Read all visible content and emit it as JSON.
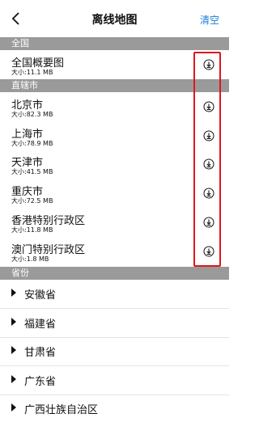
{
  "header": {
    "title": "离线地图",
    "clear_label": "清空"
  },
  "sections": {
    "national": "全国",
    "municipalities": "直辖市",
    "provinces": "省份"
  },
  "national": {
    "name": "全国概要图",
    "size": "大小:11.1 MB"
  },
  "cities": [
    {
      "name": "北京市",
      "size": "大小:82.3 MB"
    },
    {
      "name": "上海市",
      "size": "大小:78.9 MB"
    },
    {
      "name": "天津市",
      "size": "大小:41.5 MB"
    },
    {
      "name": "重庆市",
      "size": "大小:72.5 MB"
    },
    {
      "name": "香港特别行政区",
      "size": "大小:11.8 MB"
    },
    {
      "name": "澳门特别行政区",
      "size": "大小:1.8 MB"
    }
  ],
  "provinces": [
    "安徽省",
    "福建省",
    "甘肃省",
    "广东省",
    "广西壮族自治区"
  ],
  "colors": {
    "section_bg": "#9a9a9a",
    "accent": "#1a7cd9",
    "highlight": "#e0161b"
  },
  "icons": {
    "back": "chevron-left-icon",
    "download": "download-icon",
    "expand": "caret-right-icon"
  }
}
